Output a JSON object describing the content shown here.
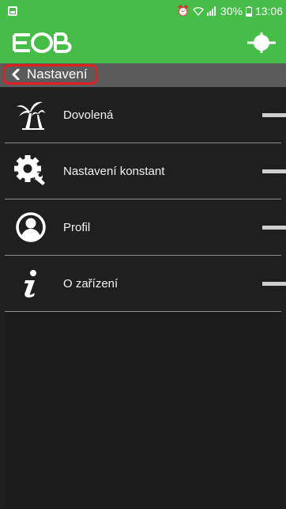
{
  "status_bar": {
    "battery_percent": "30%",
    "time": "13:06",
    "icons": [
      "notification-icon",
      "alarm-icon",
      "wifi-icon",
      "signal-icon",
      "battery-icon"
    ]
  },
  "app_bar": {
    "logo_icon": "eob-logo",
    "action_icon": "target-crosshair-icon",
    "color": "#45bd47"
  },
  "breadcrumb": {
    "back_label": "Nastavení",
    "highlight_color": "#e02020"
  },
  "menu": {
    "items": [
      {
        "label": "Dovolená",
        "icon": "palm-tree-icon"
      },
      {
        "label": "Nastavení konstant",
        "icon": "gear-wrench-icon"
      },
      {
        "label": "Profil",
        "icon": "user-circle-icon"
      },
      {
        "label": "O zařízení",
        "icon": "info-icon"
      }
    ]
  }
}
